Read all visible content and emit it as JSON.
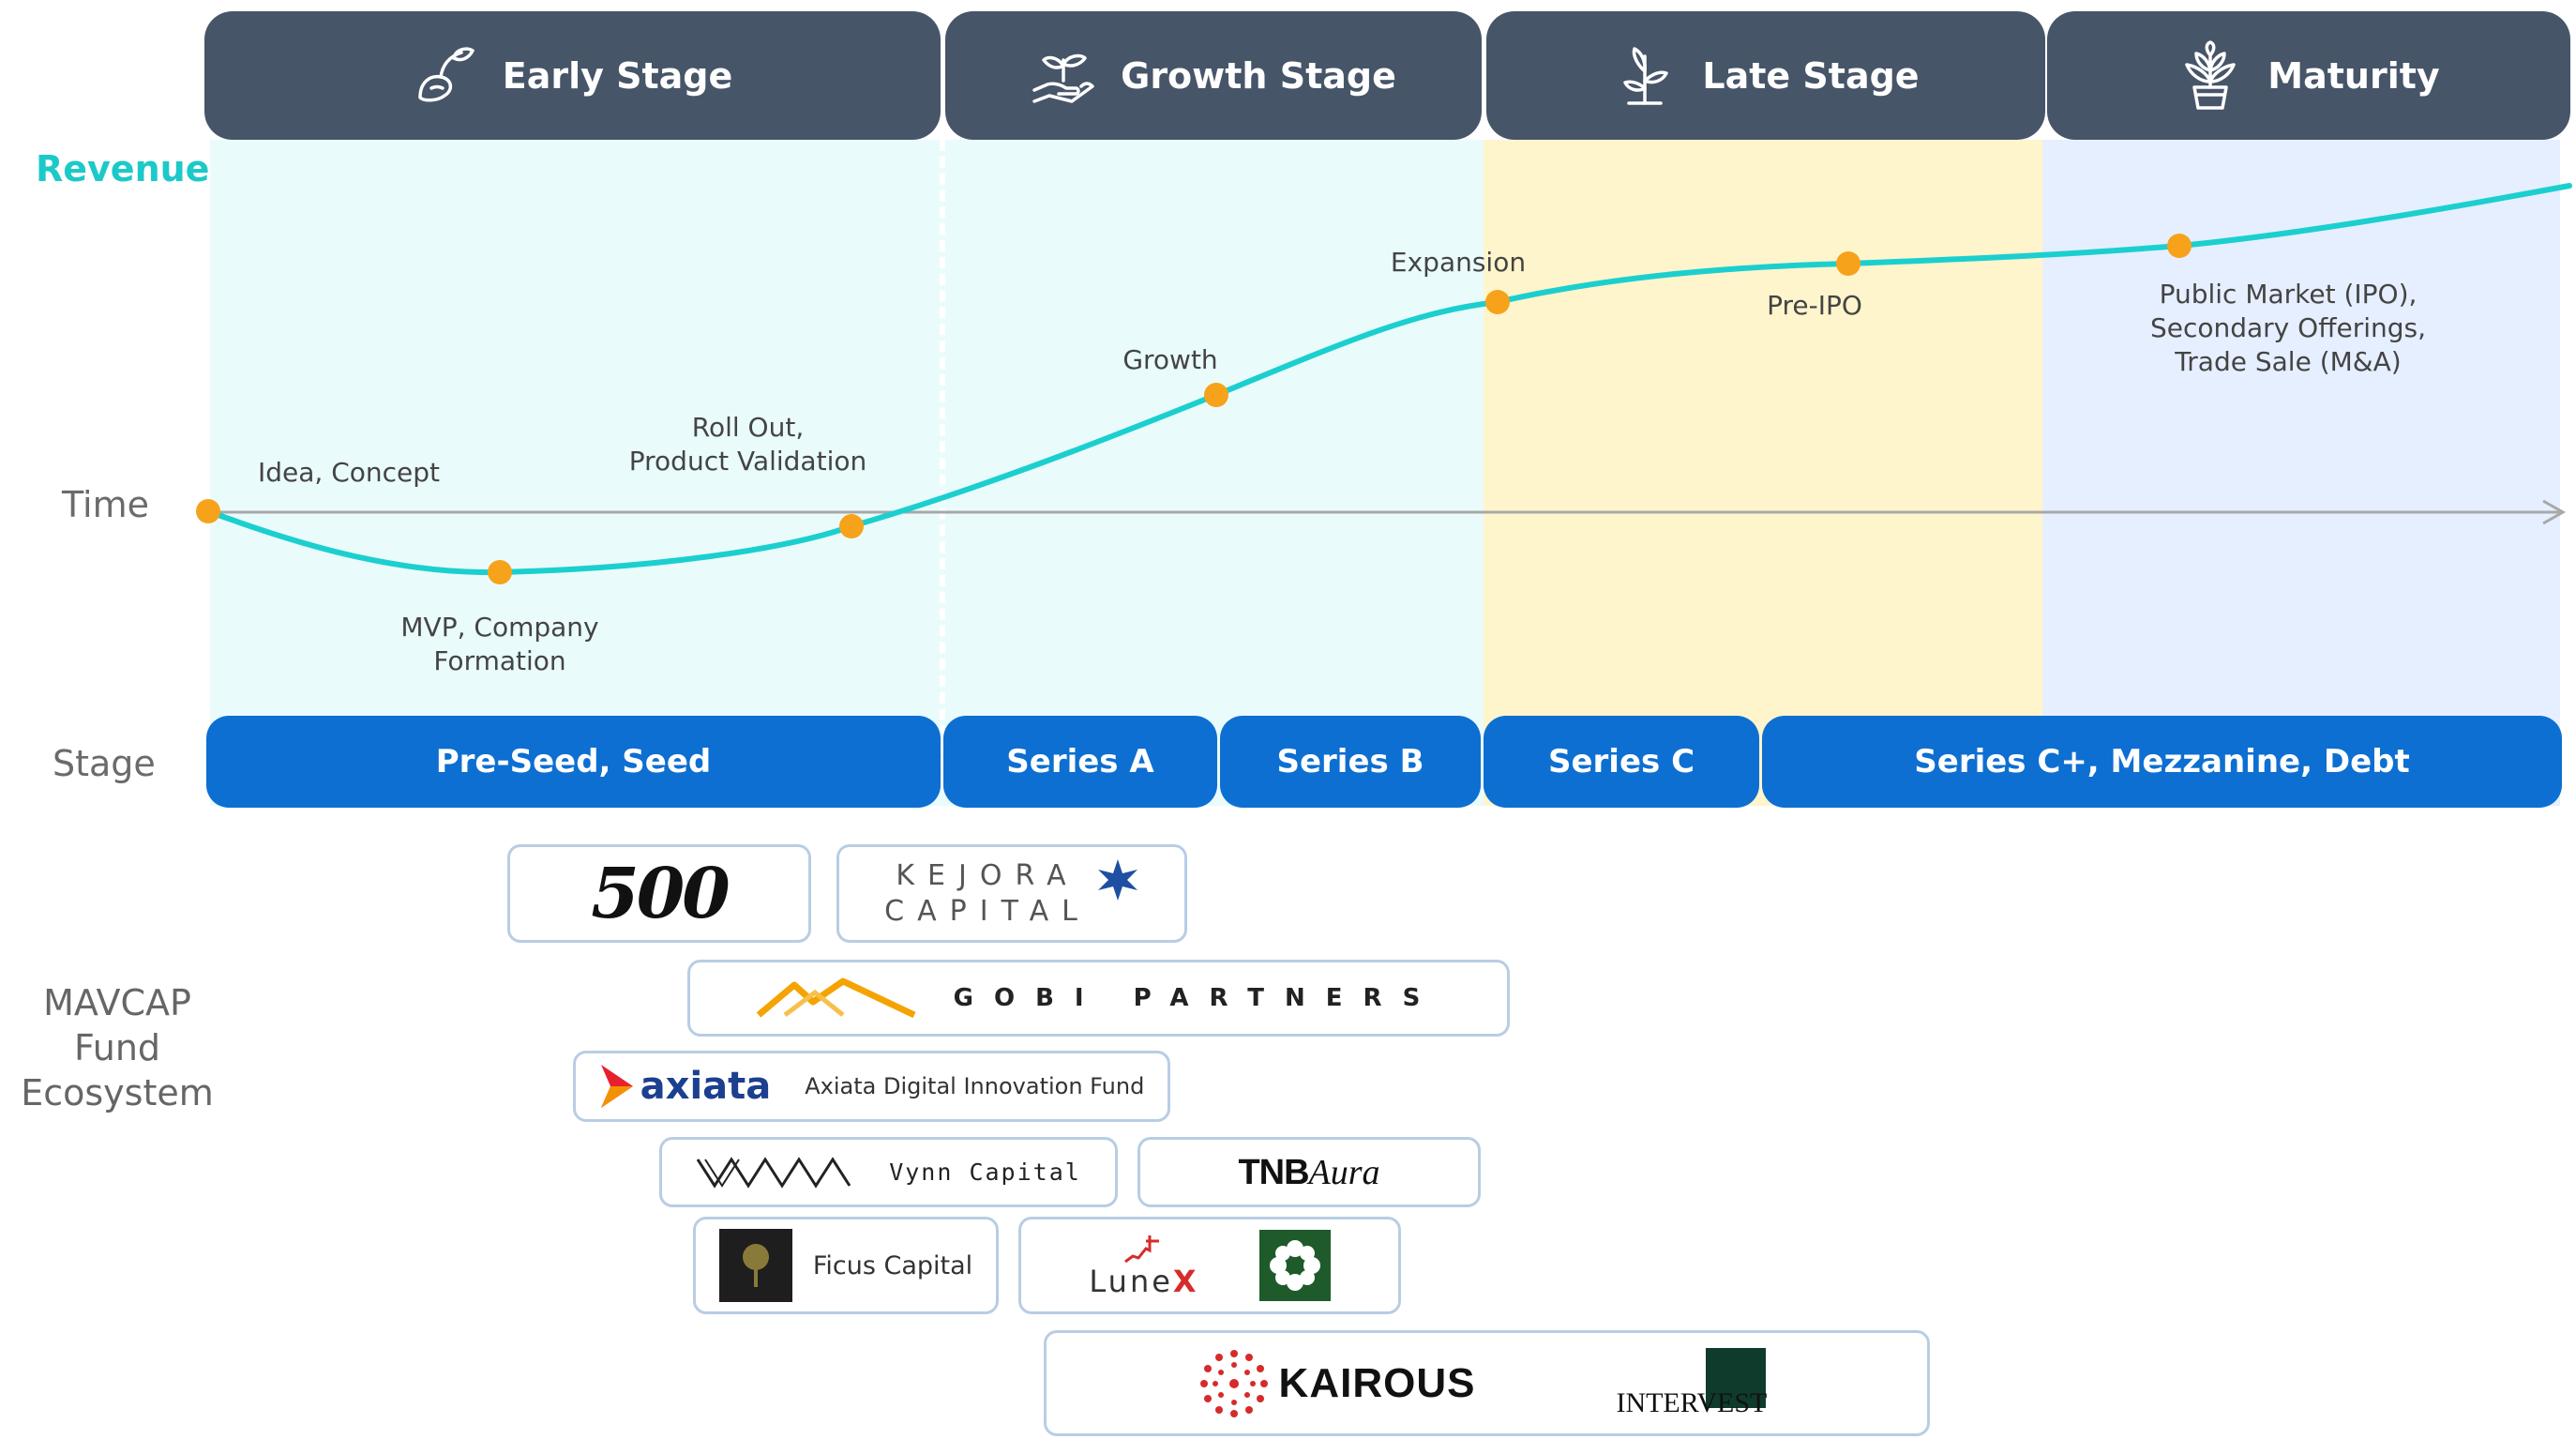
{
  "stages": [
    {
      "label": "Early Stage",
      "icon": "seedling-hand-icon"
    },
    {
      "label": "Growth Stage",
      "icon": "sprout-in-hand-icon"
    },
    {
      "label": "Late Stage",
      "icon": "young-plant-icon"
    },
    {
      "label": "Maturity",
      "icon": "potted-plant-icon"
    }
  ],
  "side_labels": {
    "revenue": "Revenue",
    "time": "Time",
    "stage": "Stage"
  },
  "curve_points": [
    {
      "label": "Idea, Concept"
    },
    {
      "label": "MVP, Company\nFormation"
    },
    {
      "label": "Roll Out,\nProduct Validation"
    },
    {
      "label": "Growth"
    },
    {
      "label": "Expansion"
    },
    {
      "label": "Pre-IPO"
    },
    {
      "label": "Public Market (IPO),\nSecondary Offerings,\nTrade Sale (M&A)"
    }
  ],
  "funding_rounds": [
    "Pre-Seed,  Seed",
    "Series A",
    "Series B",
    "Series C",
    "Series C+, Mezzanine, Debt"
  ],
  "ecosystem": {
    "title": "MAVCAP\nFund\nEcosystem",
    "funds": {
      "f500": "500",
      "kejora": {
        "line1": "KEJORA",
        "line2": "CAPITAL"
      },
      "gobi": "GOBI PARTNERS",
      "axiata": {
        "brand": "axiata",
        "name": "Axiata Digital Innovation Fund"
      },
      "vynn": "Vynn Capital",
      "tnb": {
        "bold": "TNB",
        "italic": "Aura"
      },
      "ficus": "Ficus Capital",
      "lunex": {
        "main": "Lune",
        "accent": "X"
      },
      "kairous": "KAIROUS",
      "intervest": "INTERVEST"
    }
  },
  "colors": {
    "header_bg": "#475569",
    "round_bg": "#0d6fd1",
    "curve": "#1ccfcf",
    "point": "#f7a21b",
    "early_bg": "#eafbfc",
    "late_bg": "#fff5cc",
    "maturity_bg": "#e6efff",
    "revenue_label": "#1cc9c9"
  }
}
